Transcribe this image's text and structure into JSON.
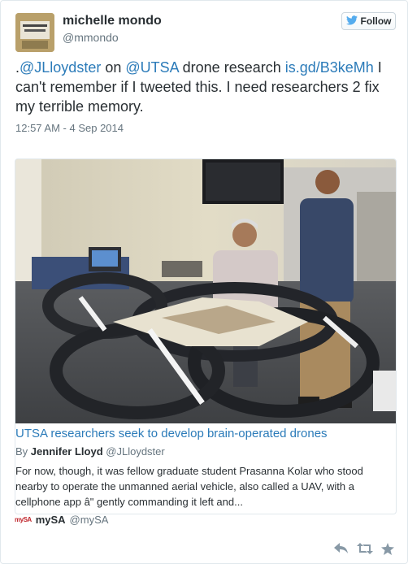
{
  "user": {
    "name": "michelle mondo",
    "handle": "@mmondo"
  },
  "follow_label": "Follow",
  "tweet": {
    "text_prefix": ".",
    "mention_1": "@JLloydster",
    "text_1": " on ",
    "mention_2": "@UTSA",
    "text_2": " drone research ",
    "link": "is.gd/B3keMh",
    "text_3": " I can't remember if I tweeted this. I need researchers 2 fix my terrible memory.",
    "timestamp": "12:57 AM - 4 Sep 2014"
  },
  "card": {
    "title": "UTSA researchers seek to develop brain-operated drones",
    "by_label": "By",
    "author": "Jennifer Lloyd",
    "author_handle": "@JLloydster",
    "description": "For now, though, it was fellow graduate student Prasanna Kolar who stood nearby to operate the unmanned aerial vehicle, also called a UAV, with a cellphone app â\" gently commanding it left and...",
    "source_logo": "mySA",
    "source_name": "mySA",
    "source_handle": "@mySA"
  },
  "icons": {
    "follow": "twitter-bird-icon",
    "reply": "reply-icon",
    "retweet": "retweet-icon",
    "favorite": "star-icon"
  },
  "colors": {
    "link": "#2b7bb9",
    "text": "#292f33",
    "muted": "#66757f",
    "twitter_blue": "#55acee"
  }
}
